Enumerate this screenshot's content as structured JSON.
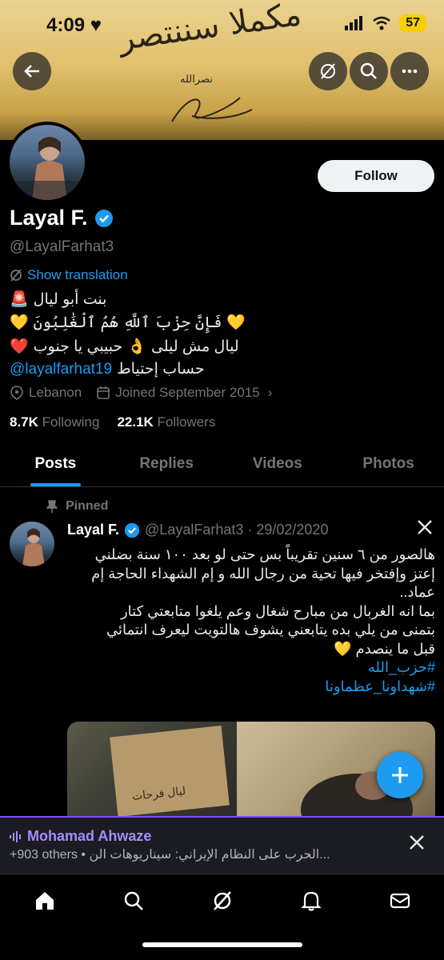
{
  "status_bar": {
    "time": "4:09",
    "battery": "57"
  },
  "banner": {
    "script_text": "مكملا سننتصر",
    "signature_text": "نصرالله"
  },
  "profile": {
    "name": "Layal F.",
    "handle": "@LayalFarhat3",
    "follow_label": "Follow",
    "show_translation": "Show translation",
    "bio": {
      "line1": "بنت أبو ليال",
      "line2": "فَإِنَّ حِزْبَ ٱللَّهِ هُمُ ٱلْغَٰلِبُونَ",
      "line3": "ليال مش ليلى",
      "line3b": "حبيبي يا جنوب",
      "line4_link": "@layalfarhat19",
      "line4_text": "حساب إحتياط"
    },
    "location": "Lebanon",
    "joined": "Joined September 2015",
    "following_count": "8.7K",
    "following_label": "Following",
    "followers_count": "22.1K",
    "followers_label": "Followers"
  },
  "tabs": [
    {
      "label": "Posts",
      "active": true
    },
    {
      "label": "Replies"
    },
    {
      "label": "Videos"
    },
    {
      "label": "Photos"
    }
  ],
  "post": {
    "pinned_label": "Pinned",
    "name": "Layal F.",
    "handle_date": "@LayalFarhat3 · 29/02/2020",
    "text_line1": "هالصور من ٦ سنين تقريباً بس حتى لو بعد ١٠٠ سنة بضلني",
    "text_line2": "إعتز وإفتخر فيها تحية من رجال الله و إم الشهداء الحاجة إم",
    "text_line3": "عماد..",
    "text_line4": "بما انه الغربال من مبارح شغال وعم يلغوا متابعتي كتار",
    "text_line5": "بتمنى من يلي بده يتابعني يشوف هالتويت ليعرف انتمائي",
    "text_line6": "قبل ما ينصدم",
    "hashtag1": "#حزب_الله",
    "hashtag2": "#شهداونا_عظماونا",
    "media_sign_text": "ليال فرحات"
  },
  "space": {
    "host": "Mohamad Ahwaze",
    "subtitle": "+903 others • الحرب على النظام الإيراني: سيناريوهات الن..."
  },
  "colors": {
    "accent": "#1d9bf0",
    "space_purple": "#7f4bff"
  }
}
